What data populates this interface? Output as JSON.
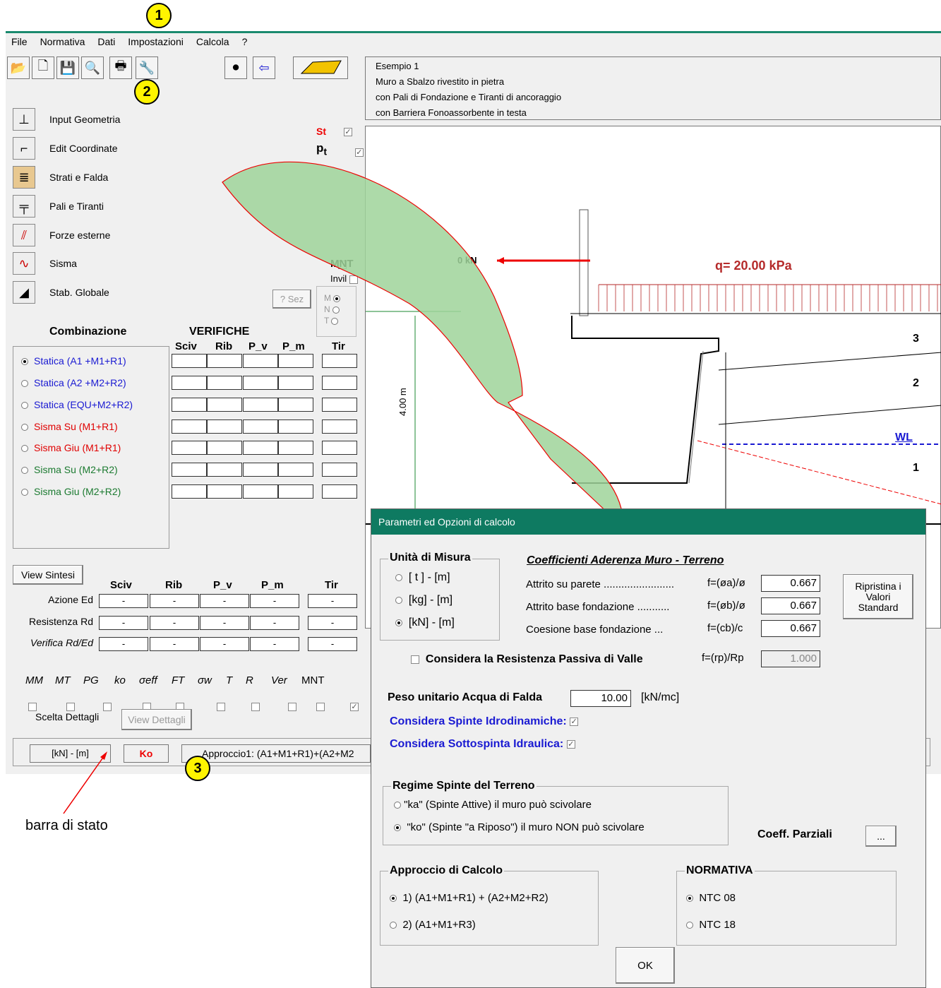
{
  "menu": [
    "File",
    "Normativa",
    "Dati",
    "Impostazioni",
    "Calcola",
    "?"
  ],
  "badges": [
    "1",
    "2",
    "3"
  ],
  "description": [
    "Esempio 1",
    "Muro a Sbalzo rivestito in pietra",
    "con Pali di Fondazione e Tiranti di ancoraggio",
    "con Barriera Fonoassorbente in testa"
  ],
  "nav": [
    {
      "label": "Input Geometria",
      "icon": "wall-icon"
    },
    {
      "label": "Edit Coordinate",
      "icon": "coordinates-icon"
    },
    {
      "label": "Strati e Falda",
      "icon": "layers-icon"
    },
    {
      "label": "Pali e Tiranti",
      "icon": "piles-icon"
    },
    {
      "label": "Forze esterne",
      "icon": "forces-icon"
    },
    {
      "label": "Sisma",
      "icon": "seismic-icon"
    },
    {
      "label": "Stab. Globale",
      "icon": "stability-icon"
    }
  ],
  "flags": {
    "st": "St",
    "pt": "p",
    "pt_sub": "t",
    "mnt": "MNT",
    "invil": "Invil",
    "sez": "? Sez",
    "m": "M",
    "n": "N",
    "t": "T"
  },
  "combinazione": {
    "title": "Combinazione",
    "verifiche_title": "VERIFICHE",
    "cols": [
      "Sciv",
      "Rib",
      "P_v",
      "P_m",
      "Tir"
    ],
    "rows": [
      {
        "label": "Statica  (A1 +M1+R1)",
        "color": "#1a1ad2",
        "selected": true
      },
      {
        "label": "Statica  (A2 +M2+R2)",
        "color": "#1a1ad2",
        "selected": false
      },
      {
        "label": "Statica  (EQU+M2+R2)",
        "color": "#1a1ad2",
        "selected": false
      },
      {
        "label": "Sisma Su  (M1+R1)",
        "color": "#e00000",
        "selected": false
      },
      {
        "label": "Sisma Giu (M1+R1)",
        "color": "#e00000",
        "selected": false
      },
      {
        "label": "Sisma Su  (M2+R2)",
        "color": "#1b7a30",
        "selected": false
      },
      {
        "label": "Sisma Giu (M2+R2)",
        "color": "#1b7a30",
        "selected": false
      }
    ]
  },
  "sintesi": {
    "button": "View Sintesi",
    "cols": [
      "Sciv",
      "Rib",
      "P_v",
      "P_m",
      "Tir"
    ],
    "rows": [
      {
        "label": "Azione Ed",
        "values": [
          "-",
          "-",
          "-",
          "-",
          "-"
        ]
      },
      {
        "label": "Resistenza Rd",
        "values": [
          "-",
          "-",
          "-",
          "-",
          "-"
        ]
      },
      {
        "label": "Verifica Rd/Ed",
        "values": [
          "-",
          "-",
          "-",
          "-",
          "-"
        ]
      }
    ]
  },
  "dettagli": {
    "items": [
      "MM",
      "MT",
      "PG",
      "ko",
      "σeff",
      "FT",
      "σw",
      "T",
      "R",
      "Ver",
      "MNT"
    ],
    "label": "Scelta Dettagli",
    "button": "View Dettagli"
  },
  "statusbar": {
    "units": "[kN] - [m]",
    "status": "Ko",
    "approach": "Approccio1: (A1+M1+R1)+(A2+M2"
  },
  "annotation": "barra di stato",
  "drawing": {
    "load": "q= 20.00 kPa",
    "force": "0 kN",
    "height": "4.00 m",
    "wl": "WL",
    "layers": [
      "3",
      "2",
      "1"
    ]
  },
  "dialog": {
    "title": "Parametri ed Opzioni di calcolo",
    "units_group": "Unità di Misura",
    "units": [
      {
        "label": "[ t ]  -  [m]",
        "selected": false
      },
      {
        "label": "[kg]  -  [m]",
        "selected": false
      },
      {
        "label": "[kN]  -  [m]",
        "selected": true
      }
    ],
    "coeff_title": "Coefficienti Aderenza  Muro - Terreno",
    "coeff": [
      {
        "label": "Attrito su parete ........................",
        "formula": "f=(øa)/ø",
        "value": "0.667"
      },
      {
        "label": "Attrito base fondazione ...........",
        "formula": "f=(øb)/ø",
        "value": "0.667"
      },
      {
        "label": "Coesione base fondazione ...",
        "formula": "f=(cb)/c",
        "value": "0.667"
      }
    ],
    "restore_button": "Ripristina i Valori Standard",
    "passiva_label": "Considera la Resistenza Passiva di Valle",
    "passiva_formula": "f=(rp)/Rp",
    "passiva_value": "1.000",
    "peso_label": "Peso unitario Acqua di Falda",
    "peso_value": "10.00",
    "peso_unit": "[kN/mc]",
    "idrodinamiche": "Considera Spinte Idrodinamiche:",
    "sottospinta": "Considera Sottospinta Idraulica:",
    "regime_group": "Regime Spinte del Terreno",
    "regime": [
      {
        "label": "\"ka\" (Spinte Attive) il muro può scivolare",
        "selected": false
      },
      {
        "label": "\"ko\" (Spinte \"a Riposo\")  il muro NON può scivolare",
        "selected": true
      }
    ],
    "coeff_parziali": "Coeff. Parziali",
    "dots": "...",
    "approccio_group": "Approccio di Calcolo",
    "approccio": [
      {
        "label": "1)  (A1+M1+R1) + (A2+M2+R2)",
        "selected": true
      },
      {
        "label": "2)  (A1+M1+R3)",
        "selected": false
      }
    ],
    "normativa_group": "NORMATIVA",
    "normativa": [
      {
        "label": "NTC 08",
        "selected": true
      },
      {
        "label": "NTC 18",
        "selected": false
      }
    ],
    "ok": "OK"
  },
  "colors": {
    "accent": "#0e7a61",
    "arrow": "#9fd39a",
    "badge": "#fff400",
    "load": "#b52a2a"
  }
}
